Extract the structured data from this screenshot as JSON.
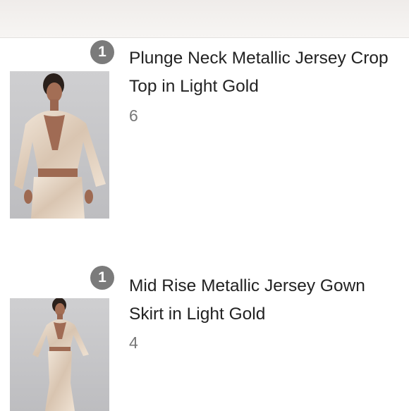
{
  "items": [
    {
      "quantity": "1",
      "name": "Plunge Neck Metallic Jersey Crop Top in Light Gold",
      "price": "6",
      "image_icon": "product-photo-crop-top"
    },
    {
      "quantity": "1",
      "name": "Mid Rise Metallic Jersey Gown Skirt in Light Gold",
      "price": "4",
      "image_icon": "product-photo-gown-skirt"
    }
  ],
  "colors": {
    "badge": "#7b7b7b",
    "name_text": "#222222",
    "price_text": "#777777",
    "photo_background": "#c6c6c8",
    "fabric_gold": "#e6d6c4"
  }
}
